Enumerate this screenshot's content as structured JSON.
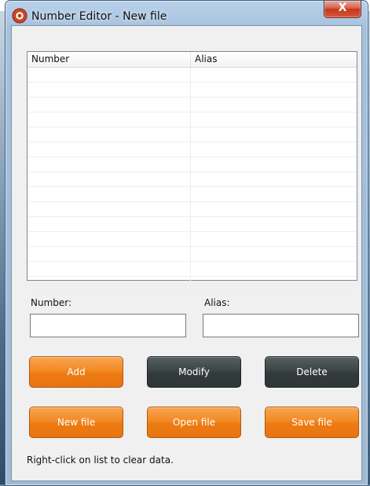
{
  "window": {
    "title": "Number Editor - New file",
    "close_label": "X"
  },
  "background": {
    "caption": "page"
  },
  "list": {
    "columns": [
      "Number",
      "Alias"
    ],
    "rows": []
  },
  "form": {
    "number_label": "Number:",
    "alias_label": "Alias:",
    "number_value": "",
    "alias_value": ""
  },
  "buttons": {
    "add": "Add",
    "modify": "Modify",
    "delete": "Delete",
    "new_file": "New file",
    "open_file": "Open file",
    "save_file": "Save file"
  },
  "status": "Right-click on list to clear data.",
  "colors": {
    "orange": "#f28a24",
    "dark": "#3c4546",
    "close": "#c2391f"
  },
  "icons": {
    "app": "app-logo-icon",
    "close": "close-icon"
  }
}
